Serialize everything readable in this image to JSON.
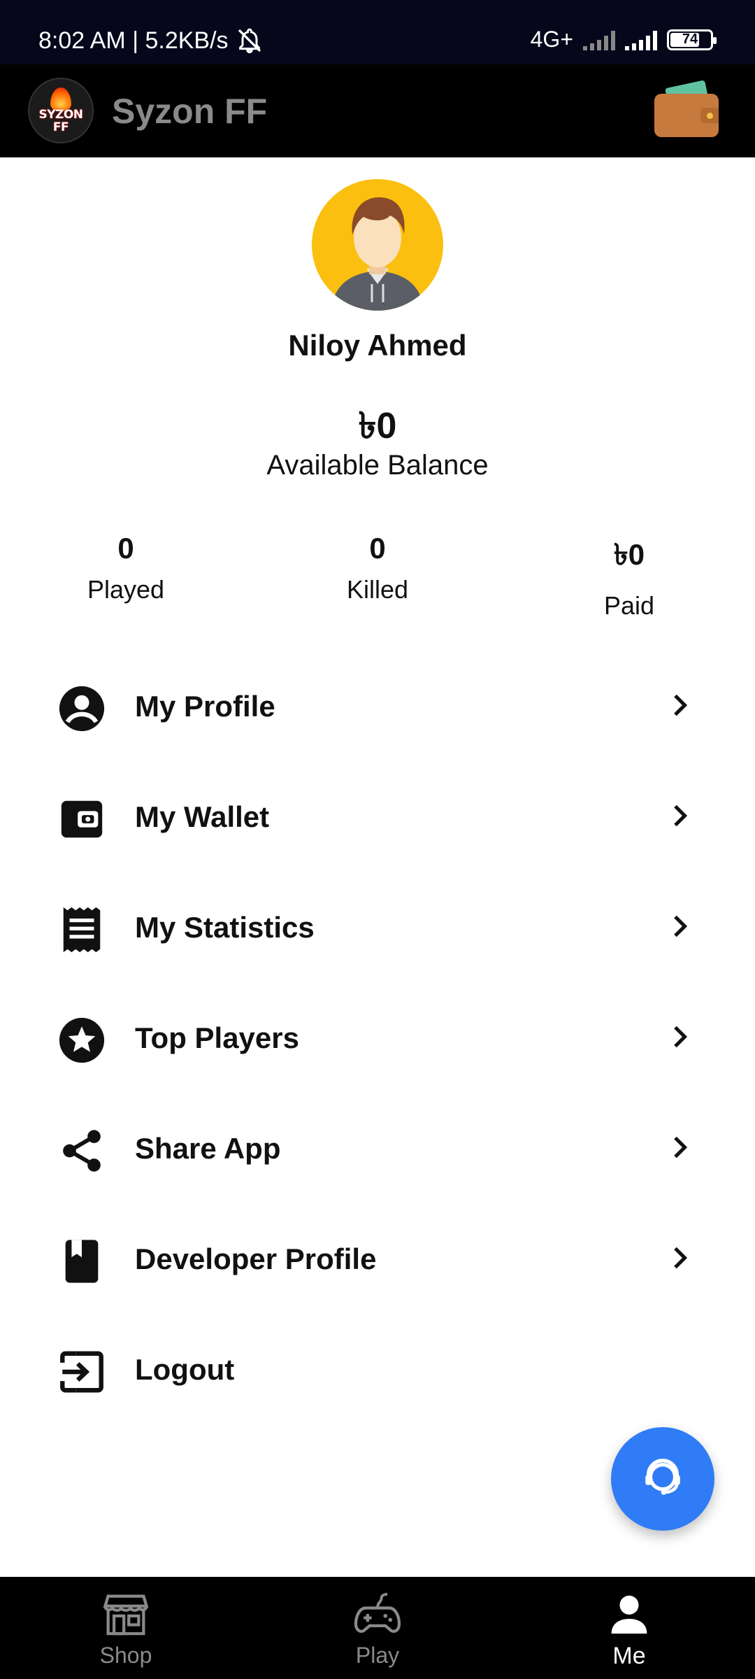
{
  "status_bar": {
    "time_speed": "8:02 AM | 5.2KB/s",
    "network": "4G+",
    "battery": "74",
    "battery_level": 0.74
  },
  "app_bar": {
    "logo_text": "SYZON FF",
    "title": "Syzon FF",
    "wallet_icon": "wallet-icon"
  },
  "profile": {
    "name": "Niloy Ahmed",
    "balance": "৳0",
    "balance_label": "Available Balance"
  },
  "stats": [
    {
      "value": "0",
      "label": "Played"
    },
    {
      "value": "0",
      "label": "Killed"
    },
    {
      "value": "৳0",
      "label": "Paid"
    }
  ],
  "menu": [
    {
      "label": "My Profile",
      "icon": "account-circle-icon"
    },
    {
      "label": "My Wallet",
      "icon": "wallet-icon"
    },
    {
      "label": "My Statistics",
      "icon": "receipt-icon"
    },
    {
      "label": "Top Players",
      "icon": "star-icon"
    },
    {
      "label": "Share App",
      "icon": "share-icon"
    },
    {
      "label": "Developer Profile",
      "icon": "book-icon"
    },
    {
      "label": "Logout",
      "icon": "logout-icon"
    }
  ],
  "fab": {
    "icon": "support-agent-icon"
  },
  "bottom_nav": [
    {
      "label": "Shop",
      "icon": "store-icon"
    },
    {
      "label": "Play",
      "icon": "gamepad-icon"
    },
    {
      "label": "Me",
      "icon": "person-icon",
      "active": true
    }
  ],
  "colors": {
    "status_bar": "#07071c",
    "app_bar": "#000000",
    "avatar_bg": "#fbbf10",
    "fab": "#2f7cf6",
    "title": "#8a8a8a"
  }
}
